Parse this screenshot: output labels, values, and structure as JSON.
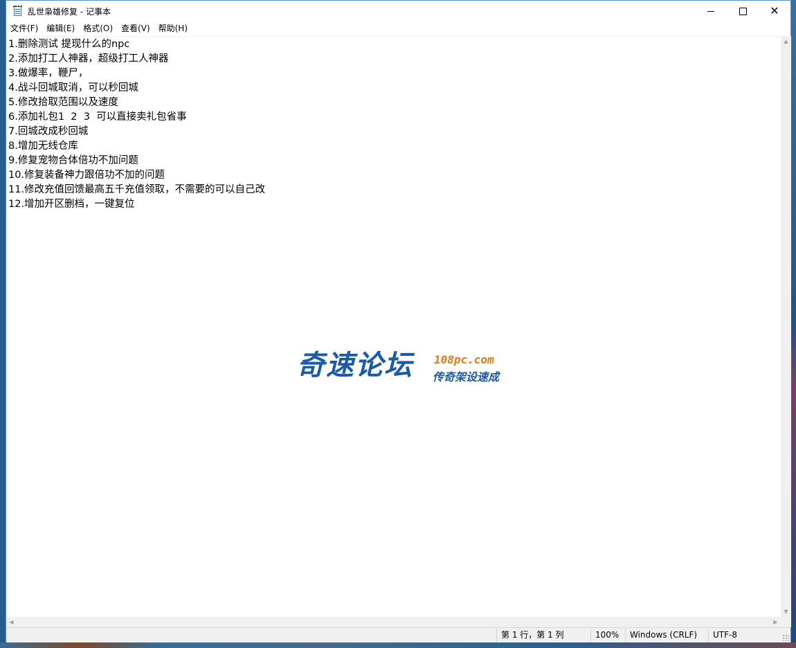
{
  "window": {
    "title": "乱世枭雄修复 - 记事本"
  },
  "menu": [
    "文件(F)",
    "编辑(E)",
    "格式(O)",
    "查看(V)",
    "帮助(H)"
  ],
  "editor": {
    "lines": [
      "1.删除测试 提现什么的npc",
      "2.添加打工人神器，超级打工人神器",
      "3.做爆率，鞭尸，",
      "4.战斗回城取消，可以秒回城",
      "5.修改拾取范围以及速度",
      "6.添加礼包1  2  3  可以直接卖礼包省事",
      "7.回城改成秒回城",
      "8.增加无线仓库",
      "9.修复宠物合体倍功不加问题",
      "10.修复装备神力跟倍功不加的问题",
      "11.修改充值回馈最高五千充值领取，不需要的可以自己改",
      "12.增加开区删档，一键复位"
    ]
  },
  "watermark": {
    "main": "奇速论坛",
    "url": "108pc.com",
    "sub": "传奇架设速成"
  },
  "status": {
    "position": "第 1 行，第 1 列",
    "zoom": "100%",
    "line_ending": "Windows (CRLF)",
    "encoding": "UTF-8"
  },
  "icons": {
    "app": "notepad-icon",
    "minimize": "minimize-icon",
    "maximize": "maximize-icon",
    "close": "close-icon"
  }
}
